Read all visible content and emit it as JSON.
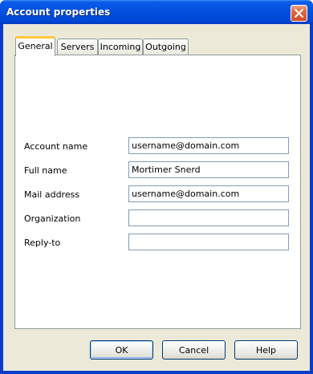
{
  "window": {
    "title": "Account properties",
    "close_icon": "close-icon"
  },
  "tabs": [
    {
      "label": "General",
      "active": true
    },
    {
      "label": "Servers",
      "active": false
    },
    {
      "label": "Incoming",
      "active": false
    },
    {
      "label": "Outgoing",
      "active": false
    }
  ],
  "form": {
    "account_name": {
      "label": "Account name",
      "value": "username@domain.com"
    },
    "full_name": {
      "label": "Full name",
      "value": "Mortimer Snerd"
    },
    "mail_address": {
      "label": "Mail address",
      "value": "username@domain.com"
    },
    "organization": {
      "label": "Organization",
      "value": ""
    },
    "reply_to": {
      "label": "Reply-to",
      "value": ""
    }
  },
  "buttons": {
    "ok": "OK",
    "cancel": "Cancel",
    "help": "Help"
  },
  "colors": {
    "titlebar": "#0453e0",
    "close_button": "#d34a22",
    "dialog_background": "#ece9d8",
    "active_tab_accent": "#ffc83c"
  }
}
